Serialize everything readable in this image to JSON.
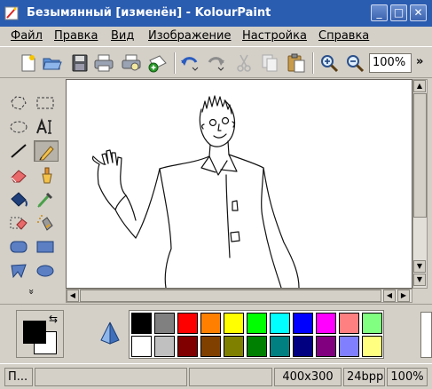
{
  "window": {
    "title": "Безымянный [изменён] - KolourPaint",
    "minimize_glyph": "_",
    "maximize_glyph": "□",
    "close_glyph": "✕",
    "title_bar_color": "#2a5cb0"
  },
  "menu": {
    "items": [
      "Файл",
      "Правка",
      "Вид",
      "Изображение",
      "Настройка",
      "Справка"
    ]
  },
  "toolbar": {
    "icons": [
      "new-icon",
      "open-icon",
      "save-icon",
      "print-icon",
      "print-preview-icon",
      "mail-icon",
      "undo-icon",
      "redo-icon",
      "cut-icon",
      "copy-icon",
      "paste-icon",
      "zoom-in-icon",
      "zoom-out-icon"
    ],
    "zoom_value": "100%",
    "more_glyph": "»"
  },
  "tools": {
    "items": [
      "free-form-selection",
      "rectangle-selection",
      "ellipse-selection",
      "text",
      "line",
      "pen",
      "eraser",
      "brush",
      "flood-fill",
      "color-picker",
      "color-eraser",
      "spraycan",
      "rounded-rectangle",
      "rectangle",
      "polygon",
      "ellipse"
    ],
    "active": "pen",
    "more_glyph": "»"
  },
  "colors": {
    "foreground": "#000000",
    "background": "#ffffff",
    "swap_glyph": "⇆",
    "palette_top": [
      "#000000",
      "#808080",
      "#ff0000",
      "#ff8000",
      "#ffff00",
      "#00ff00",
      "#00ffff",
      "#0000ff",
      "#ff00ff",
      "#ff8080",
      "#80ff80"
    ],
    "palette_bottom": [
      "#ffffff",
      "#c0c0c0",
      "#800000",
      "#804000",
      "#808000",
      "#008000",
      "#008080",
      "#000080",
      "#800080",
      "#8080ff",
      "#ffff80"
    ]
  },
  "status": {
    "message": "П...",
    "dimensions": "400x300",
    "depth": "24bpp",
    "zoom": "100%"
  }
}
